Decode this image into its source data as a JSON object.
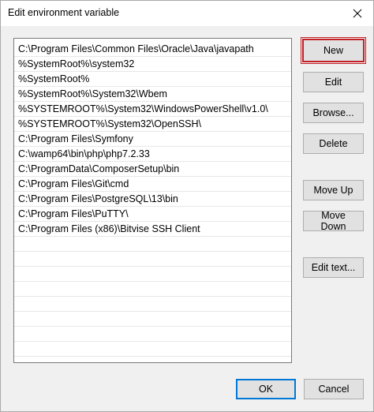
{
  "window": {
    "title": "Edit environment variable",
    "close_glyph": "✕"
  },
  "paths": [
    "C:\\Program Files\\Common Files\\Oracle\\Java\\javapath",
    "%SystemRoot%\\system32",
    "%SystemRoot%",
    "%SystemRoot%\\System32\\Wbem",
    "%SYSTEMROOT%\\System32\\WindowsPowerShell\\v1.0\\",
    "%SYSTEMROOT%\\System32\\OpenSSH\\",
    "C:\\Program Files\\Symfony",
    "C:\\wamp64\\bin\\php\\php7.2.33",
    "C:\\ProgramData\\ComposerSetup\\bin",
    "C:\\Program Files\\Git\\cmd",
    "C:\\Program Files\\PostgreSQL\\13\\bin",
    "C:\\Program Files\\PuTTY\\",
    "C:\\Program Files (x86)\\Bitvise SSH Client"
  ],
  "empty_rows": 8,
  "buttons": {
    "new": "New",
    "edit": "Edit",
    "browse": "Browse...",
    "delete": "Delete",
    "move_up": "Move Up",
    "move_down": "Move Down",
    "edit_text": "Edit text...",
    "ok": "OK",
    "cancel": "Cancel"
  },
  "colors": {
    "highlight_border": "#c32026",
    "default_button_border": "#0078d7"
  }
}
